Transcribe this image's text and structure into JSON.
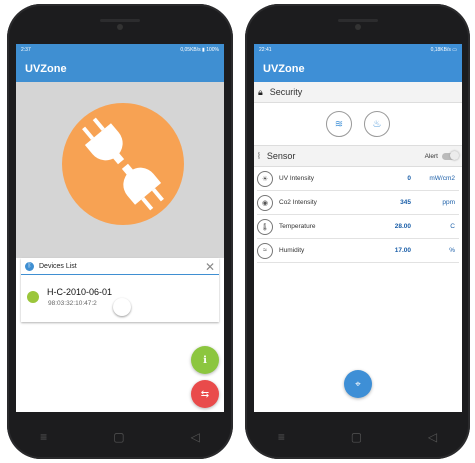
{
  "left_phone": {
    "status": {
      "time": "2:37",
      "right": "0,05KB/s",
      "battery": "100%"
    },
    "app_title": "UVZone",
    "devices_list": {
      "title": "Devices List",
      "device": {
        "name": "H-C-2010-06-01",
        "mac": "98:03:32:10:47:2"
      }
    },
    "fab_info_icon": "info-icon",
    "fab_share_icon": "share-icon"
  },
  "right_phone": {
    "status": {
      "time": "22:41",
      "right": "0,18KB/s"
    },
    "app_title": "UVZone",
    "security": {
      "label": "Security"
    },
    "sensor": {
      "label": "Sensor",
      "alert_label": "Alert",
      "rows": [
        {
          "label": "UV Intensity",
          "value": "0",
          "unit": "mW/cm2"
        },
        {
          "label": "Co2 Intensity",
          "value": "345",
          "unit": "ppm"
        },
        {
          "label": "Temperature",
          "value": "28.00",
          "unit": "C"
        },
        {
          "label": "Humidity",
          "value": "17.00",
          "unit": "%"
        }
      ]
    }
  },
  "colors": {
    "app_blue": "#3f8fd2",
    "plug_orange": "#f7a253",
    "fab_green": "#8cc63f",
    "fab_red": "#e94b4b"
  }
}
